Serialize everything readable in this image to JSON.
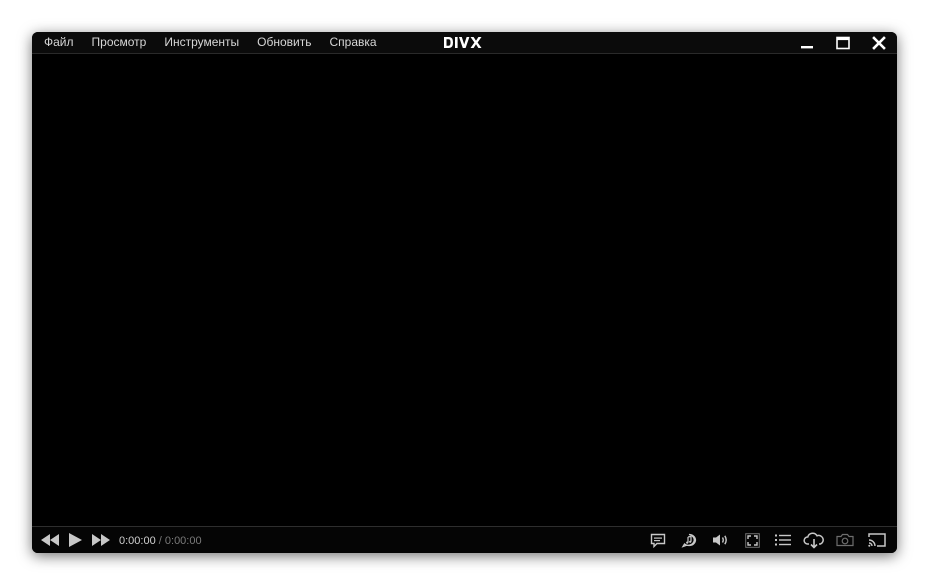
{
  "window": {
    "brand_logo": "DIVX"
  },
  "menu": {
    "items": [
      {
        "label": "Файл"
      },
      {
        "label": "Просмотр"
      },
      {
        "label": "Инструменты"
      },
      {
        "label": "Обновить"
      },
      {
        "label": "Справка"
      }
    ]
  },
  "window_controls": {
    "icons": [
      "minimize-icon",
      "maximize-icon",
      "close-icon"
    ]
  },
  "player": {
    "current_time": "0:00:00",
    "separator": "/",
    "duration": "0:00:00"
  },
  "controls": {
    "left_icons": [
      "rewind-icon",
      "play-icon",
      "fast-forward-icon"
    ],
    "right_icons": [
      "subtitles-icon",
      "audio-track-icon",
      "volume-icon",
      "fullscreen-icon",
      "playlist-icon",
      "cloud-download-icon",
      "screenshot-icon",
      "cast-icon"
    ]
  },
  "colors": {
    "background": "#000000",
    "text": "#d6d6d6",
    "muted_text": "#7a7a7a",
    "icon": "#c8c8c8"
  }
}
